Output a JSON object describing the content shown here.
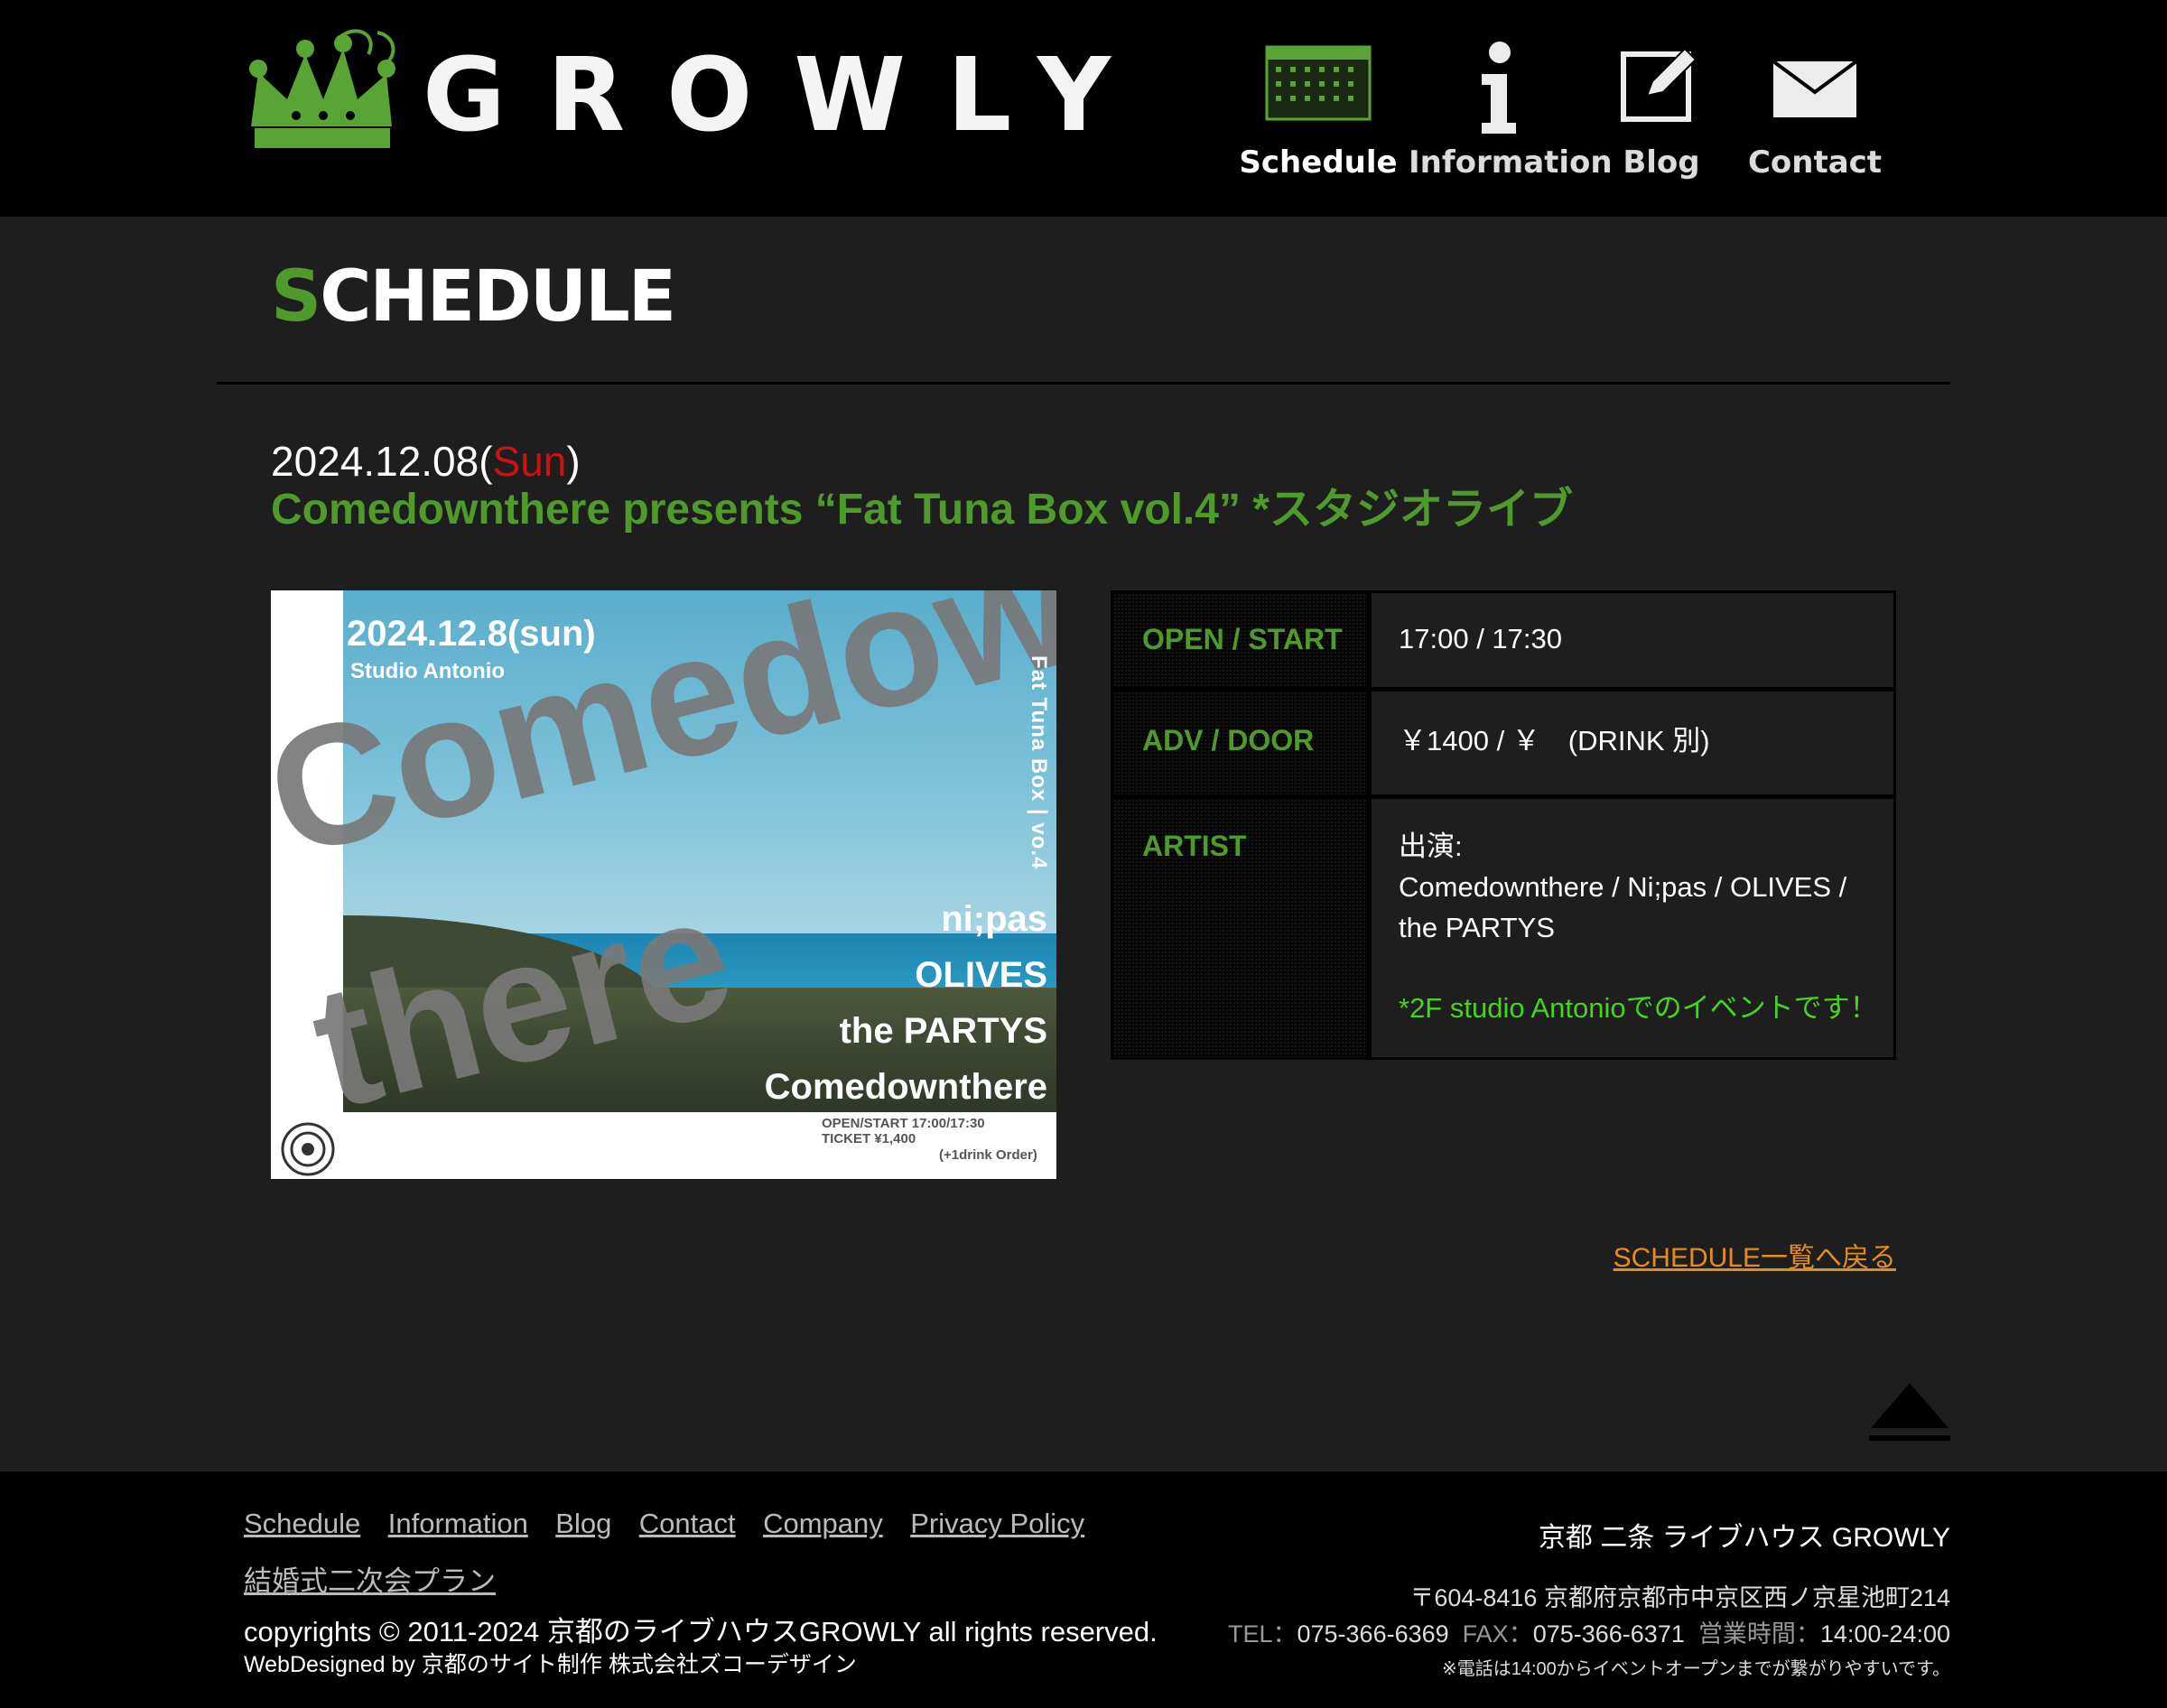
{
  "site": {
    "logo_text": "GROWLY"
  },
  "nav": {
    "items": [
      {
        "label": "Schedule",
        "icon": "calendar-icon"
      },
      {
        "label": "Information",
        "icon": "info-icon"
      },
      {
        "label": "Blog",
        "icon": "pencil-icon"
      },
      {
        "label": "Contact",
        "icon": "envelope-icon"
      }
    ],
    "active": "Schedule"
  },
  "page": {
    "heading_first": "S",
    "heading_rest": "CHEDULE"
  },
  "event": {
    "date": "2024.12.08(",
    "dow": "Sun",
    "date_close": ")",
    "title": "Comedownthere presents “Fat Tuna Box vol.4” *スタジオライブ"
  },
  "flyer": {
    "date": "2024.12.8(sun)",
    "venue": "Studio Antonio",
    "big_line1": "Comedown",
    "big_line2": "there",
    "vertical": "Fat Tuna Box | vo.4",
    "artists": [
      "ni;pas",
      "OLIVES",
      "the PARTYS",
      "Comedownthere"
    ],
    "info_line1": "OPEN/START   17:00/17:30",
    "info_line2": "TICKET           ¥1,400",
    "info_line3": "(+1drink Order)"
  },
  "info": {
    "open_label": "OPEN / START",
    "open_value": "17:00 / 17:30",
    "adv_label": "ADV / DOOR",
    "adv_value": "￥1400 / ￥　(DRINK 別)",
    "artist_label": "ARTIST",
    "artist_prefix": "出演:",
    "artist_line1": "Comedownthere / Ni;pas / OLIVES /",
    "artist_line2": "the PARTYS",
    "artist_note": "*2F studio Antonioでのイベントです！"
  },
  "back_link": "SCHEDULE一覧へ戻る",
  "colors": {
    "accent_green": "#4e9a2a",
    "note_green": "#48d31c",
    "link_orange": "#e58c1f",
    "sunday_red": "#cc1111"
  },
  "footer": {
    "links": [
      "Schedule",
      "Information",
      "Blog",
      "Contact",
      "Company",
      "Privacy Policy"
    ],
    "link2": "結婚式二次会プラン",
    "copyright": "copyrights © 2011-2024 京都のライブハウスGROWLY all rights reserved.",
    "designed": "WebDesigned by 京都のサイト制作 株式会社ズコーデザイン",
    "venue_name": "京都 二条 ライブハウス GROWLY",
    "address": "〒604-8416 京都府京都市中京区西ノ京星池町214",
    "tel_label": "TEL：",
    "tel": "075-366-6369",
    "fax_label": "FAX：",
    "fax": "075-366-6371",
    "hours_label": "営業時間：",
    "hours": "14:00-24:00",
    "remark": "※電話は14:00からイベントオープンまでが繋がりやすいです。"
  }
}
